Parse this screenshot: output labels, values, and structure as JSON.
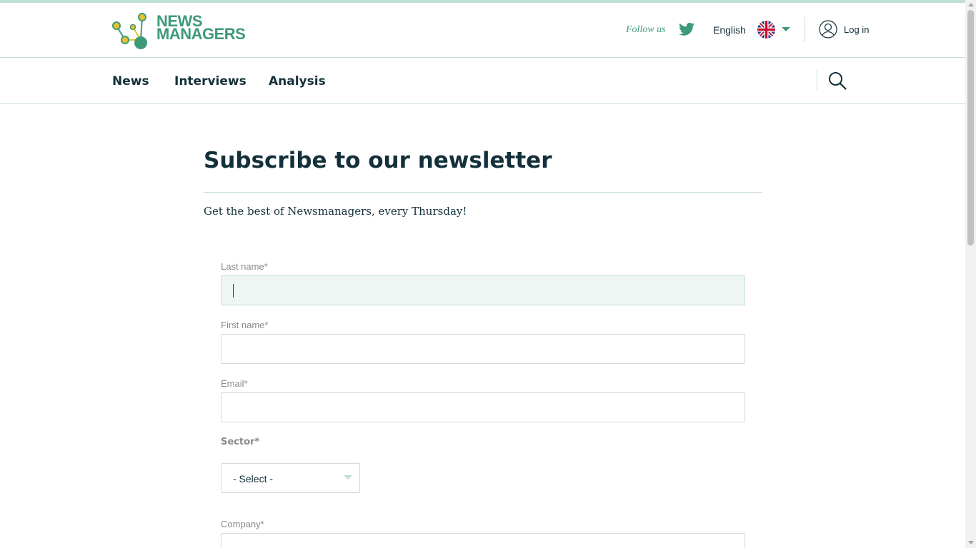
{
  "header": {
    "logo_line1": "NEWS",
    "logo_line2": "MANAGERS",
    "follow_label": "Follow us",
    "language": "English",
    "login_label": "Log in"
  },
  "nav": {
    "items": [
      "News",
      "Interviews",
      "Analysis"
    ]
  },
  "main": {
    "title": "Subscribe to our newsletter",
    "subtitle": "Get the best of Newsmanagers, every Thursday!"
  },
  "form": {
    "last_name_label": "Last name*",
    "first_name_label": "First name*",
    "email_label": "Email*",
    "sector_label": "Sector*",
    "sector_selected": "- Select -",
    "company_label": "Company*"
  },
  "colors": {
    "brand_green": "#3d9a78",
    "text_dark": "#14303a",
    "focus_bg": "#eef5f2",
    "accent_light": "#bfe0d4"
  },
  "icons": {
    "twitter": "twitter-icon",
    "flag": "uk-flag-icon",
    "user": "user-icon",
    "search": "search-icon"
  }
}
